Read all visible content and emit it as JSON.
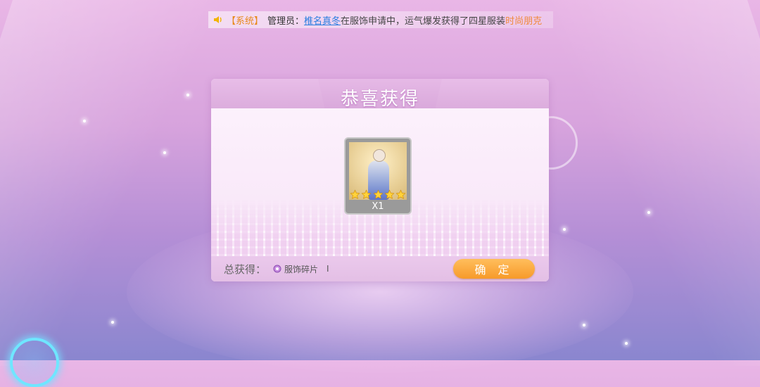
{
  "announcement": {
    "tag": "【系统】",
    "speaker": "管理员：",
    "player_name": "椎名真冬",
    "text_mid": "在服饰申请中，运气爆发获得了四星服装",
    "item_name": "时尚朋克"
  },
  "dialog": {
    "title": "恭喜获得",
    "reward": {
      "stars": 5,
      "quantity_label": "X1"
    },
    "footer": {
      "total_label": "总获得：",
      "shard_name": "服饰碎片",
      "shard_count": "I",
      "confirm_label": "确 定"
    }
  },
  "colors": {
    "accent_orange": "#f79a2a",
    "link_blue": "#2b7ee0",
    "header_pink": "#dcaddd"
  }
}
